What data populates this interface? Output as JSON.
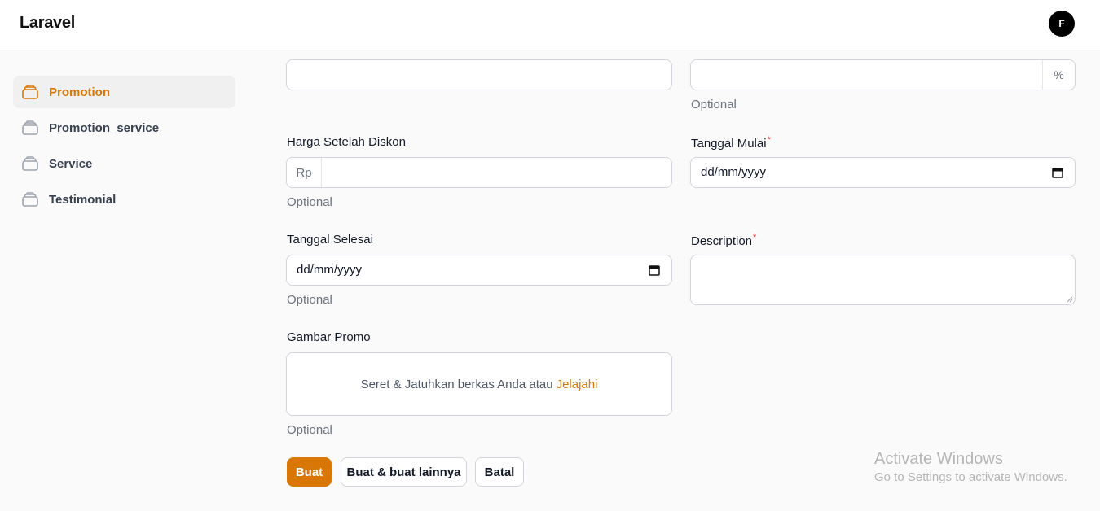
{
  "header": {
    "brand": "Laravel",
    "avatar_initial": "F"
  },
  "sidebar": {
    "items": [
      {
        "label": "Promotion",
        "active": true
      },
      {
        "label": "Promotion_service",
        "active": false
      },
      {
        "label": "Service",
        "active": false
      },
      {
        "label": "Testimonial",
        "active": false
      }
    ]
  },
  "form": {
    "top_left_value": "",
    "discount": {
      "value": "",
      "suffix": "%",
      "hint": "Optional"
    },
    "price_after_discount": {
      "label": "Harga Setelah Diskon",
      "prefix": "Rp",
      "value": "",
      "hint": "Optional"
    },
    "start_date": {
      "label": "Tanggal Mulai",
      "required": "*",
      "value": "dd/mm/yyyy"
    },
    "end_date": {
      "label": "Tanggal Selesai",
      "value": "dd/mm/yyyy",
      "hint": "Optional"
    },
    "description": {
      "label": "Description",
      "required": "*",
      "value": ""
    },
    "image": {
      "label": "Gambar Promo",
      "dropzone_text": "Seret & Jatuhkan berkas Anda atau",
      "browse_link": "Jelajahi",
      "hint": "Optional"
    }
  },
  "actions": {
    "create": "Buat",
    "create_another": "Buat & buat lainnya",
    "cancel": "Batal"
  },
  "watermark": {
    "title": "Activate Windows",
    "subtitle": "Go to Settings to activate Windows."
  },
  "colors": {
    "accent": "#d97706",
    "required": "#dc2626",
    "border": "#d1d5db"
  }
}
